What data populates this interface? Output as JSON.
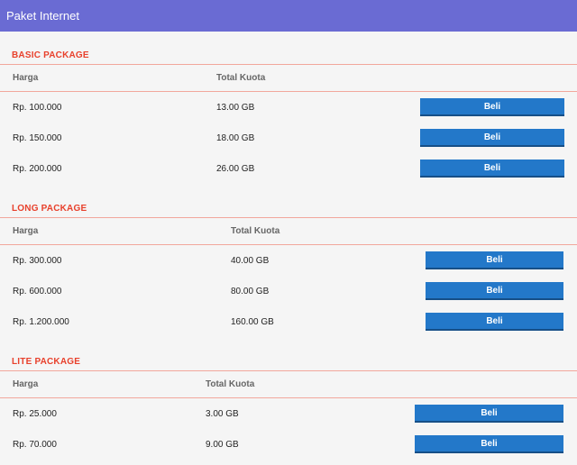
{
  "header": {
    "title": "Paket Internet"
  },
  "columns": {
    "price": "Harga",
    "quota": "Total Kuota"
  },
  "button_label": "Beli",
  "colors": {
    "header": "#6a6bd3",
    "accent": "#e8412c",
    "button": "#2378c9"
  },
  "sections": [
    {
      "title": "BASIC PACKAGE",
      "rows": [
        {
          "price": "Rp. 100.000",
          "quota": "13.00 GB"
        },
        {
          "price": "Rp. 150.000",
          "quota": "18.00 GB"
        },
        {
          "price": "Rp. 200.000",
          "quota": "26.00 GB"
        }
      ]
    },
    {
      "title": "LONG PACKAGE",
      "rows": [
        {
          "price": "Rp. 300.000",
          "quota": "40.00 GB"
        },
        {
          "price": "Rp. 600.000",
          "quota": "80.00 GB"
        },
        {
          "price": "Rp. 1.200.000",
          "quota": "160.00 GB"
        }
      ]
    },
    {
      "title": "LITE PACKAGE",
      "rows": [
        {
          "price": "Rp. 25.000",
          "quota": "3.00 GB"
        },
        {
          "price": "Rp. 70.000",
          "quota": "9.00 GB"
        }
      ]
    }
  ]
}
